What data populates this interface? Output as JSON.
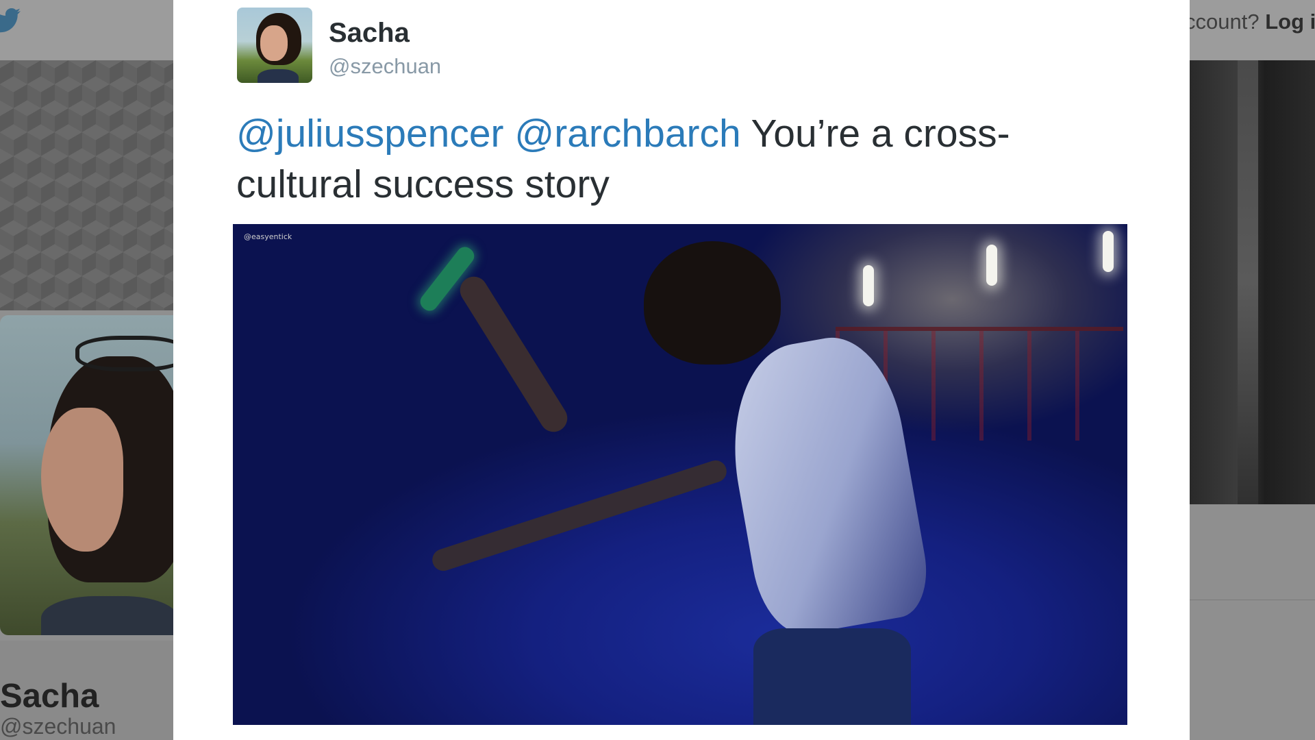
{
  "background_page": {
    "login_prompt": "ccount?",
    "login_link": "Log in",
    "profile_name": "Sacha",
    "profile_handle": "@szechuan"
  },
  "tweet": {
    "author": {
      "name": "Sacha",
      "handle": "@szechuan"
    },
    "mentions": [
      "@juliusspencer",
      "@rarchbarch"
    ],
    "text": "You’re a cross-cultural success story",
    "media": {
      "type": "gif",
      "watermark": "@easyentick"
    }
  },
  "colors": {
    "mention": "#2b7bb9",
    "handle": "#8899a6",
    "text": "#292f33"
  },
  "icons": {
    "brand": "twitter-bird-icon"
  }
}
